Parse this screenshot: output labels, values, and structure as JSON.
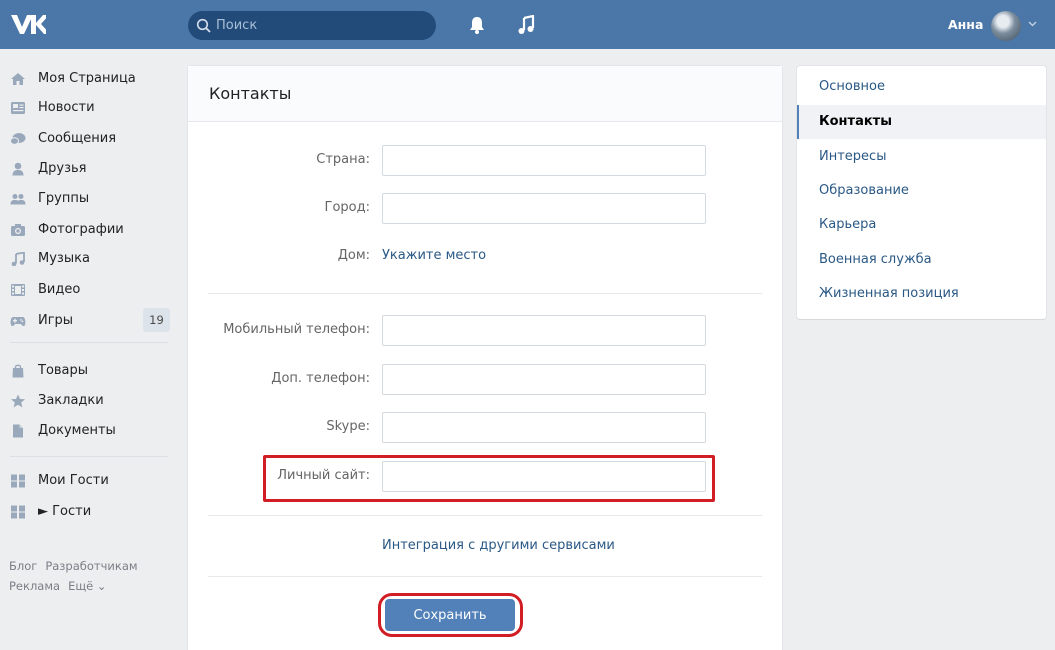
{
  "header": {
    "logo": "vk-logo-icon",
    "search_placeholder": "Поиск",
    "user_name": "Анна",
    "icons": [
      "search-icon",
      "bell-icon",
      "music-note-icon",
      "chevron-down-icon"
    ],
    "color": "#4a76a8"
  },
  "sidebar": {
    "items": [
      {
        "label": "Моя Страница",
        "icon": "home-icon"
      },
      {
        "label": "Новости",
        "icon": "news-icon"
      },
      {
        "label": "Сообщения",
        "icon": "messages-icon"
      },
      {
        "label": "Друзья",
        "icon": "friend-icon"
      },
      {
        "label": "Группы",
        "icon": "groups-icon"
      },
      {
        "label": "Фотографии",
        "icon": "camera-icon"
      },
      {
        "label": "Музыка",
        "icon": "music-icon"
      },
      {
        "label": "Видео",
        "icon": "video-icon"
      },
      {
        "label": "Игры",
        "icon": "gamepad-icon",
        "badge": "19"
      },
      {
        "label": "Товары",
        "icon": "bag-icon"
      },
      {
        "label": "Закладки",
        "icon": "star-icon"
      },
      {
        "label": "Документы",
        "icon": "document-icon"
      },
      {
        "label": "Мои Гости",
        "icon": "app-grid-icon"
      },
      {
        "label": "► Гости",
        "icon": "app-grid-icon"
      }
    ],
    "footer": {
      "row1": [
        "Блог",
        "Разработчикам"
      ],
      "row2": [
        "Реклама",
        "Ещё ⌄"
      ]
    }
  },
  "main": {
    "title": "Контакты",
    "country_label": "Страна:",
    "city_label": "Город:",
    "home_label": "Дом:",
    "home_link": "Укажите место",
    "mobile_label": "Мобильный телефон:",
    "extra_phone_label": "Доп. телефон:",
    "skype_label": "Skype:",
    "site_label": "Личный сайт:",
    "integration_link": "Интеграция с другими сервисами",
    "save_label": "Сохранить",
    "highlight_color": "#d11d24"
  },
  "right_menu": {
    "items": [
      {
        "label": "Основное",
        "active": false
      },
      {
        "label": "Контакты",
        "active": true
      },
      {
        "label": "Интересы",
        "active": false
      },
      {
        "label": "Образование",
        "active": false
      },
      {
        "label": "Карьера",
        "active": false
      },
      {
        "label": "Военная служба",
        "active": false
      },
      {
        "label": "Жизненная позиция",
        "active": false
      }
    ]
  }
}
